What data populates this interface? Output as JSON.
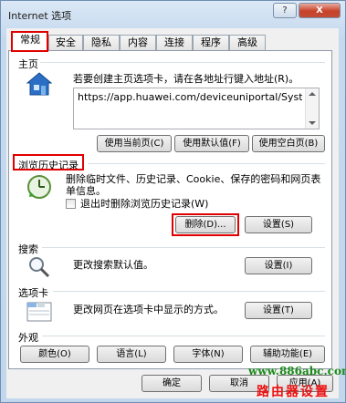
{
  "window": {
    "title": "Internet 选项",
    "help_label": "?",
    "close_label": "X"
  },
  "tabs": [
    {
      "label": "常规",
      "active": true
    },
    {
      "label": "安全"
    },
    {
      "label": "隐私"
    },
    {
      "label": "内容"
    },
    {
      "label": "连接"
    },
    {
      "label": "程序"
    },
    {
      "label": "高级"
    }
  ],
  "home": {
    "section_label": "主页",
    "description": "若要创建主页选项卡，请在各地址行键入地址(R)。",
    "url": "https://app.huawei.com/deviceuniportal/Systen",
    "use_current_label": "使用当前页(C)",
    "use_default_label": "使用默认值(F)",
    "use_blank_label": "使用空白页(B)"
  },
  "history": {
    "section_label": "浏览历史记录",
    "description": "删除临时文件、历史记录、Cookie、保存的密码和网页表单信息。",
    "checkbox_label": "退出时删除浏览历史记录(W)",
    "delete_label": "删除(D)...",
    "settings_label": "设置(S)"
  },
  "search": {
    "section_label": "搜索",
    "description": "更改搜索默认值。",
    "settings_label": "设置(I)"
  },
  "tabs_section": {
    "section_label": "选项卡",
    "description": "更改网页在选项卡中显示的方式。",
    "settings_label": "设置(T)"
  },
  "appearance": {
    "section_label": "外观",
    "colors_label": "颜色(O)",
    "languages_label": "语言(L)",
    "fonts_label": "字体(N)",
    "accessibility_label": "辅助功能(E)"
  },
  "footer": {
    "ok_label": "确定",
    "cancel_label": "取消",
    "apply_label": "应用(A)"
  },
  "watermark": {
    "site": "www.886abc.com",
    "brand": "路由器设置"
  },
  "colors": {
    "highlight_red": "#e00000",
    "titlebar_blue": "#c5d9ee",
    "close_red": "#c7412a"
  }
}
